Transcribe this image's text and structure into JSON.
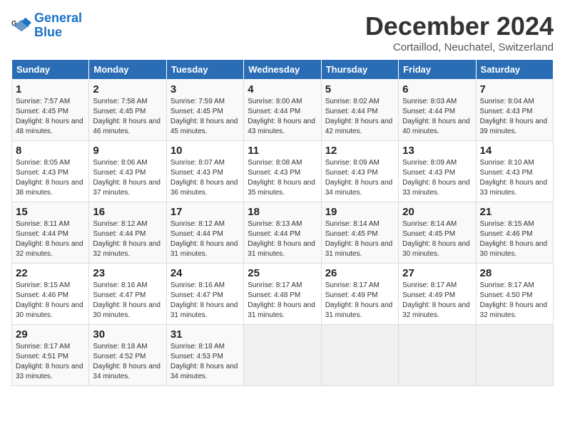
{
  "logo": {
    "line1": "General",
    "line2": "Blue"
  },
  "title": "December 2024",
  "subtitle": "Cortaillod, Neuchatel, Switzerland",
  "days_of_week": [
    "Sunday",
    "Monday",
    "Tuesday",
    "Wednesday",
    "Thursday",
    "Friday",
    "Saturday"
  ],
  "weeks": [
    [
      {
        "day": "1",
        "sunrise": "7:57 AM",
        "sunset": "4:45 PM",
        "daylight": "8 hours and 48 minutes."
      },
      {
        "day": "2",
        "sunrise": "7:58 AM",
        "sunset": "4:45 PM",
        "daylight": "8 hours and 46 minutes."
      },
      {
        "day": "3",
        "sunrise": "7:59 AM",
        "sunset": "4:45 PM",
        "daylight": "8 hours and 45 minutes."
      },
      {
        "day": "4",
        "sunrise": "8:00 AM",
        "sunset": "4:44 PM",
        "daylight": "8 hours and 43 minutes."
      },
      {
        "day": "5",
        "sunrise": "8:02 AM",
        "sunset": "4:44 PM",
        "daylight": "8 hours and 42 minutes."
      },
      {
        "day": "6",
        "sunrise": "8:03 AM",
        "sunset": "4:44 PM",
        "daylight": "8 hours and 40 minutes."
      },
      {
        "day": "7",
        "sunrise": "8:04 AM",
        "sunset": "4:43 PM",
        "daylight": "8 hours and 39 minutes."
      }
    ],
    [
      {
        "day": "8",
        "sunrise": "8:05 AM",
        "sunset": "4:43 PM",
        "daylight": "8 hours and 38 minutes."
      },
      {
        "day": "9",
        "sunrise": "8:06 AM",
        "sunset": "4:43 PM",
        "daylight": "8 hours and 37 minutes."
      },
      {
        "day": "10",
        "sunrise": "8:07 AM",
        "sunset": "4:43 PM",
        "daylight": "8 hours and 36 minutes."
      },
      {
        "day": "11",
        "sunrise": "8:08 AM",
        "sunset": "4:43 PM",
        "daylight": "8 hours and 35 minutes."
      },
      {
        "day": "12",
        "sunrise": "8:09 AM",
        "sunset": "4:43 PM",
        "daylight": "8 hours and 34 minutes."
      },
      {
        "day": "13",
        "sunrise": "8:09 AM",
        "sunset": "4:43 PM",
        "daylight": "8 hours and 33 minutes."
      },
      {
        "day": "14",
        "sunrise": "8:10 AM",
        "sunset": "4:43 PM",
        "daylight": "8 hours and 33 minutes."
      }
    ],
    [
      {
        "day": "15",
        "sunrise": "8:11 AM",
        "sunset": "4:44 PM",
        "daylight": "8 hours and 32 minutes."
      },
      {
        "day": "16",
        "sunrise": "8:12 AM",
        "sunset": "4:44 PM",
        "daylight": "8 hours and 32 minutes."
      },
      {
        "day": "17",
        "sunrise": "8:12 AM",
        "sunset": "4:44 PM",
        "daylight": "8 hours and 31 minutes."
      },
      {
        "day": "18",
        "sunrise": "8:13 AM",
        "sunset": "4:44 PM",
        "daylight": "8 hours and 31 minutes."
      },
      {
        "day": "19",
        "sunrise": "8:14 AM",
        "sunset": "4:45 PM",
        "daylight": "8 hours and 31 minutes."
      },
      {
        "day": "20",
        "sunrise": "8:14 AM",
        "sunset": "4:45 PM",
        "daylight": "8 hours and 30 minutes."
      },
      {
        "day": "21",
        "sunrise": "8:15 AM",
        "sunset": "4:46 PM",
        "daylight": "8 hours and 30 minutes."
      }
    ],
    [
      {
        "day": "22",
        "sunrise": "8:15 AM",
        "sunset": "4:46 PM",
        "daylight": "8 hours and 30 minutes."
      },
      {
        "day": "23",
        "sunrise": "8:16 AM",
        "sunset": "4:47 PM",
        "daylight": "8 hours and 30 minutes."
      },
      {
        "day": "24",
        "sunrise": "8:16 AM",
        "sunset": "4:47 PM",
        "daylight": "8 hours and 31 minutes."
      },
      {
        "day": "25",
        "sunrise": "8:17 AM",
        "sunset": "4:48 PM",
        "daylight": "8 hours and 31 minutes."
      },
      {
        "day": "26",
        "sunrise": "8:17 AM",
        "sunset": "4:49 PM",
        "daylight": "8 hours and 31 minutes."
      },
      {
        "day": "27",
        "sunrise": "8:17 AM",
        "sunset": "4:49 PM",
        "daylight": "8 hours and 32 minutes."
      },
      {
        "day": "28",
        "sunrise": "8:17 AM",
        "sunset": "4:50 PM",
        "daylight": "8 hours and 32 minutes."
      }
    ],
    [
      {
        "day": "29",
        "sunrise": "8:17 AM",
        "sunset": "4:51 PM",
        "daylight": "8 hours and 33 minutes."
      },
      {
        "day": "30",
        "sunrise": "8:18 AM",
        "sunset": "4:52 PM",
        "daylight": "8 hours and 34 minutes."
      },
      {
        "day": "31",
        "sunrise": "8:18 AM",
        "sunset": "4:53 PM",
        "daylight": "8 hours and 34 minutes."
      },
      null,
      null,
      null,
      null
    ]
  ]
}
